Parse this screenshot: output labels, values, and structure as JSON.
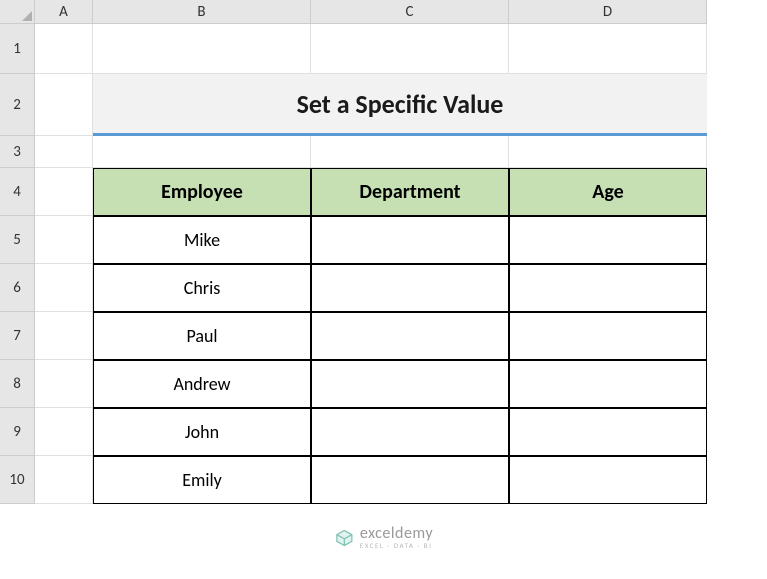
{
  "columns": [
    "A",
    "B",
    "C",
    "D"
  ],
  "rows": [
    "1",
    "2",
    "3",
    "4",
    "5",
    "6",
    "7",
    "8",
    "9",
    "10"
  ],
  "title": "Set a Specific Value",
  "table": {
    "headers": [
      "Employee",
      "Department",
      "Age"
    ],
    "data": [
      {
        "employee": "Mike",
        "department": "",
        "age": ""
      },
      {
        "employee": "Chris",
        "department": "",
        "age": ""
      },
      {
        "employee": "Paul",
        "department": "",
        "age": ""
      },
      {
        "employee": "Andrew",
        "department": "",
        "age": ""
      },
      {
        "employee": "John",
        "department": "",
        "age": ""
      },
      {
        "employee": "Emily",
        "department": "",
        "age": ""
      }
    ]
  },
  "watermark": {
    "main": "exceldemy",
    "sub": "EXCEL · DATA · BI"
  }
}
